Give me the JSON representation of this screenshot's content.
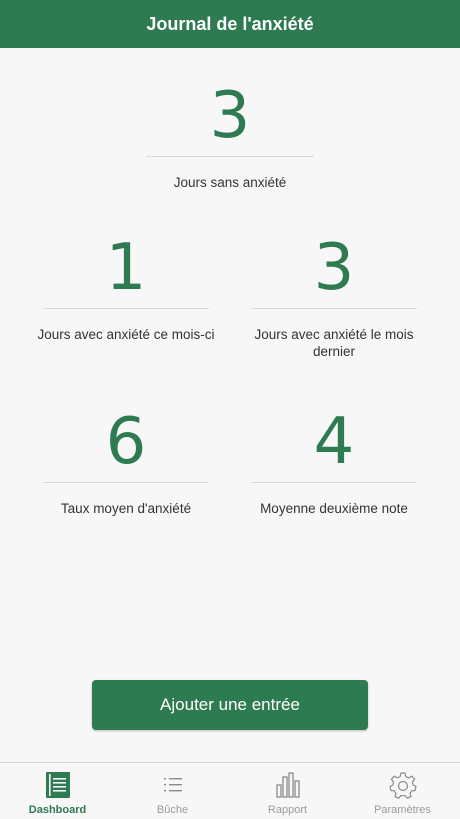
{
  "header": {
    "title": "Journal de l'anxiété"
  },
  "stats": {
    "days_without": {
      "value": "3",
      "label": "Jours sans anxiété"
    },
    "days_this_month": {
      "value": "1",
      "label": "Jours avec anxiété ce mois-ci"
    },
    "days_last_month": {
      "value": "3",
      "label": "Jours avec anxiété le mois dernier"
    },
    "avg_rate": {
      "value": "6",
      "label": "Taux moyen d'anxiété"
    },
    "avg_second": {
      "value": "4",
      "label": "Moyenne deuxième note"
    }
  },
  "add_button": {
    "label": "Ajouter une entrée"
  },
  "tabs": [
    {
      "label": "Dashboard",
      "icon": "dashboard-icon",
      "active": true
    },
    {
      "label": "Bûche",
      "icon": "list-icon",
      "active": false
    },
    {
      "label": "Rapport",
      "icon": "bar-chart-icon",
      "active": false
    },
    {
      "label": "Paramètres",
      "icon": "gear-icon",
      "active": false
    }
  ],
  "colors": {
    "primary": "#2e7a51",
    "inactive": "#9a9a9a",
    "background": "#f7f7f7"
  }
}
